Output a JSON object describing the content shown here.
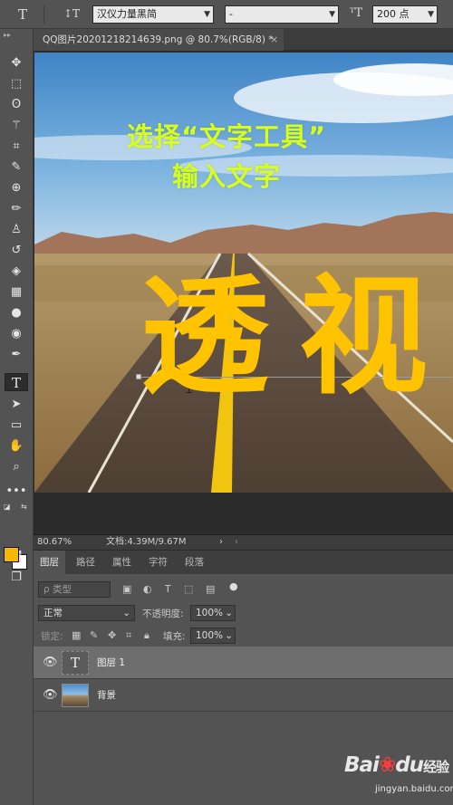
{
  "options_bar": {
    "font_family": "汉仪力量黑简",
    "font_style": "-",
    "font_size": "200 点",
    "icons": [
      "text-tool-icon",
      "text-orientation-icon",
      "font-size-icon"
    ]
  },
  "document_tab": {
    "title": "QQ图片20201218214639.png @ 80.7%(RGB/8) *",
    "close": "×"
  },
  "canvas": {
    "caption_line1": "选择“文字工具”",
    "caption_line2": "输入文字",
    "big_text": [
      "透",
      "视"
    ],
    "big_text_color": "#ffc300",
    "caption_color": "#d8ff1c"
  },
  "status_bar": {
    "zoom": "80.67%",
    "doc_info": "文档:4.39M/9.67M",
    "arrow": "›"
  },
  "layers_panel": {
    "tabs": [
      "图层",
      "路径",
      "属性",
      "字符",
      "段落"
    ],
    "active_tab": "图层",
    "filter_placeholder": "ρ 类型",
    "blend_mode": "正常",
    "opacity_label": "不透明度:",
    "opacity_value": "100%",
    "lock_label": "锁定:",
    "fill_label": "填充:",
    "fill_value": "100%",
    "layers": [
      {
        "name": "图层 1",
        "type": "text",
        "thumb_glyph": "T",
        "selected": true
      },
      {
        "name": "背景",
        "type": "image",
        "selected": false
      }
    ]
  },
  "toolbar": {
    "tools": [
      "move-icon",
      "marquee-icon",
      "lasso-icon",
      "magic-wand-icon",
      "crop-icon",
      "eyedropper-icon",
      "healing-icon",
      "brush-icon",
      "clone-stamp-icon",
      "history-brush-icon",
      "eraser-icon",
      "gradient-icon",
      "blur-icon",
      "dodge-icon",
      "pen-icon",
      "text-tool-icon",
      "path-select-icon",
      "rectangle-icon",
      "hand-icon",
      "zoom-icon",
      "more-icon"
    ],
    "active_tool": "text-tool-icon",
    "foreground_color": "#f5b800",
    "background_color": "#ffffff"
  },
  "watermark": {
    "logo_bai": "Bai",
    "logo_du": "du",
    "logo_jingyan": "经验",
    "url": "jingyan.baidu.com"
  }
}
